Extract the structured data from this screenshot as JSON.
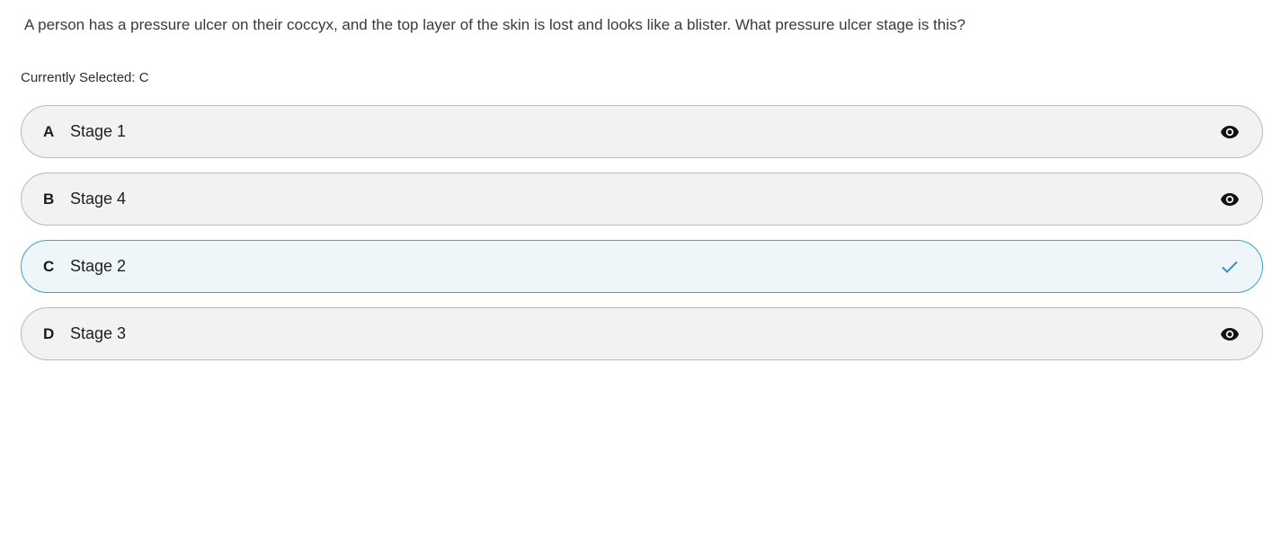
{
  "question": {
    "text": "A person has a pressure ulcer on their coccyx, and the top layer of the skin is lost and looks like a blister. What pressure ulcer stage is this?"
  },
  "selection": {
    "text": "Currently Selected: C"
  },
  "options": [
    {
      "letter": "A",
      "label": "Stage 1",
      "icon": "eye-icon",
      "selected": false
    },
    {
      "letter": "B",
      "label": "Stage 4",
      "icon": "eye-icon",
      "selected": false
    },
    {
      "letter": "C",
      "label": "Stage 2",
      "icon": "check-icon",
      "selected": true
    },
    {
      "letter": "D",
      "label": "Stage 3",
      "icon": "eye-icon",
      "selected": false
    }
  ],
  "colors": {
    "selected_border": "#3aa0d6",
    "selected_background": "#eef6fa",
    "option_background": "#f2f2f2",
    "check": "#3a8fc4"
  }
}
